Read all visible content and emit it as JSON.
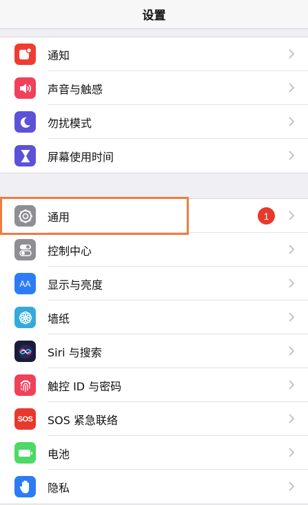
{
  "header": {
    "title": "设置"
  },
  "groups": [
    {
      "items": [
        {
          "label": "通知",
          "icon": "notification-icon",
          "color": "#f23b30"
        },
        {
          "label": "声音与触感",
          "icon": "sound-icon",
          "color": "#f1405a"
        },
        {
          "label": "勿扰模式",
          "icon": "moon-icon",
          "color": "#5b52d8"
        },
        {
          "label": "屏幕使用时间",
          "icon": "hourglass-icon",
          "color": "#5b52d8"
        }
      ]
    },
    {
      "items": [
        {
          "label": "通用",
          "icon": "gear-icon",
          "color": "#8e8e93",
          "badge": "1",
          "highlighted": true
        },
        {
          "label": "控制中心",
          "icon": "toggle-icon",
          "color": "#8e8e93"
        },
        {
          "label": "显示与亮度",
          "icon": "text-size-icon",
          "color": "#2d7cf6",
          "icon_text": "AA"
        },
        {
          "label": "墙纸",
          "icon": "flower-icon",
          "color": "#34aadc"
        },
        {
          "label": "Siri 与搜索",
          "icon": "siri-icon",
          "color": "#1c1c3a"
        },
        {
          "label": "触控 ID 与密码",
          "icon": "fingerprint-icon",
          "color": "#f1405a"
        },
        {
          "label": "SOS 紧急联络",
          "icon": "sos-icon",
          "color": "#e8392c",
          "icon_text": "SOS"
        },
        {
          "label": "电池",
          "icon": "battery-icon",
          "color": "#4cd964"
        },
        {
          "label": "隐私",
          "icon": "hand-icon",
          "color": "#2d7cf6"
        }
      ]
    }
  ]
}
